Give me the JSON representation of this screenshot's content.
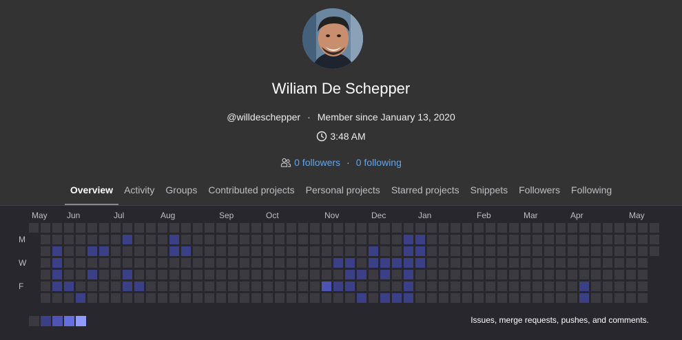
{
  "profile": {
    "name": "Wiliam De Schepper",
    "username": "@willdeschepper",
    "member_since": "Member since January 13, 2020",
    "local_time": "3:48 AM",
    "followers_label": "0 followers",
    "following_label": "0 following"
  },
  "tabs": [
    {
      "label": "Overview",
      "active": true
    },
    {
      "label": "Activity"
    },
    {
      "label": "Groups"
    },
    {
      "label": "Contributed projects"
    },
    {
      "label": "Personal projects"
    },
    {
      "label": "Starred projects"
    },
    {
      "label": "Snippets"
    },
    {
      "label": "Followers"
    },
    {
      "label": "Following"
    }
  ],
  "calendar": {
    "months": [
      "May",
      "Jun",
      "Jul",
      "Aug",
      "Sep",
      "Oct",
      "Nov",
      "Dec",
      "Jan",
      "Feb",
      "Mar",
      "Apr",
      "May"
    ],
    "day_labels": [
      "M",
      "W",
      "F"
    ],
    "legend_text": "Issues, merge requests, pushes, and comments.",
    "colors": {
      "level0": "#3b3a40",
      "level1": "#3b3f86",
      "level2": "#4e54b4",
      "level3": "#666fe0",
      "level4": "#8f9bff"
    },
    "cells": [
      [
        0,
        -1,
        -1,
        -1,
        -1,
        -1,
        -1
      ],
      [
        0,
        0,
        0,
        0,
        0,
        0,
        0
      ],
      [
        0,
        0,
        1,
        1,
        1,
        1,
        0
      ],
      [
        0,
        0,
        0,
        0,
        0,
        1,
        0
      ],
      [
        0,
        0,
        0,
        0,
        0,
        0,
        1
      ],
      [
        0,
        0,
        1,
        0,
        1,
        0,
        0
      ],
      [
        0,
        0,
        1,
        0,
        0,
        0,
        0
      ],
      [
        0,
        0,
        0,
        0,
        0,
        0,
        0
      ],
      [
        0,
        1,
        0,
        0,
        1,
        1,
        0
      ],
      [
        0,
        0,
        0,
        0,
        0,
        1,
        0
      ],
      [
        0,
        0,
        0,
        0,
        0,
        0,
        0
      ],
      [
        0,
        0,
        0,
        0,
        0,
        0,
        0
      ],
      [
        0,
        1,
        1,
        0,
        0,
        0,
        0
      ],
      [
        0,
        0,
        1,
        0,
        0,
        0,
        0
      ],
      [
        0,
        0,
        0,
        0,
        0,
        0,
        0
      ],
      [
        0,
        0,
        0,
        0,
        0,
        0,
        0
      ],
      [
        0,
        0,
        0,
        0,
        0,
        0,
        0
      ],
      [
        0,
        0,
        0,
        0,
        0,
        0,
        0
      ],
      [
        0,
        0,
        0,
        0,
        0,
        0,
        0
      ],
      [
        0,
        0,
        0,
        0,
        0,
        0,
        0
      ],
      [
        0,
        0,
        0,
        0,
        0,
        0,
        0
      ],
      [
        0,
        0,
        0,
        0,
        0,
        0,
        0
      ],
      [
        0,
        0,
        0,
        0,
        0,
        0,
        0
      ],
      [
        0,
        0,
        0,
        0,
        0,
        0,
        0
      ],
      [
        0,
        0,
        0,
        0,
        0,
        0,
        0
      ],
      [
        0,
        0,
        0,
        0,
        0,
        2,
        0
      ],
      [
        0,
        0,
        0,
        1,
        0,
        1,
        0
      ],
      [
        0,
        0,
        0,
        1,
        1,
        1,
        0
      ],
      [
        0,
        0,
        0,
        0,
        1,
        0,
        1
      ],
      [
        0,
        0,
        1,
        1,
        0,
        0,
        0
      ],
      [
        0,
        0,
        0,
        1,
        1,
        0,
        1
      ],
      [
        0,
        0,
        0,
        1,
        0,
        0,
        1
      ],
      [
        0,
        1,
        1,
        1,
        1,
        1,
        1
      ],
      [
        0,
        1,
        1,
        1,
        0,
        0,
        0
      ],
      [
        0,
        0,
        0,
        0,
        0,
        0,
        0
      ],
      [
        0,
        0,
        0,
        0,
        0,
        0,
        0
      ],
      [
        0,
        0,
        0,
        0,
        0,
        0,
        0
      ],
      [
        0,
        0,
        0,
        0,
        0,
        0,
        0
      ],
      [
        0,
        0,
        0,
        0,
        0,
        0,
        0
      ],
      [
        0,
        0,
        0,
        0,
        0,
        0,
        0
      ],
      [
        0,
        0,
        0,
        0,
        0,
        0,
        0
      ],
      [
        0,
        0,
        0,
        0,
        0,
        0,
        0
      ],
      [
        0,
        0,
        0,
        0,
        0,
        0,
        0
      ],
      [
        0,
        0,
        0,
        0,
        0,
        0,
        0
      ],
      [
        0,
        0,
        0,
        0,
        0,
        0,
        0
      ],
      [
        0,
        0,
        0,
        0,
        0,
        0,
        0
      ],
      [
        0,
        0,
        0,
        0,
        0,
        0,
        0
      ],
      [
        0,
        0,
        0,
        0,
        0,
        1,
        1
      ],
      [
        0,
        0,
        0,
        0,
        0,
        0,
        0
      ],
      [
        0,
        0,
        0,
        0,
        0,
        0,
        0
      ],
      [
        0,
        0,
        0,
        0,
        0,
        0,
        0
      ],
      [
        0,
        0,
        0,
        0,
        0,
        0,
        0
      ],
      [
        0,
        0,
        0,
        0,
        0,
        0,
        0
      ],
      [
        0,
        0,
        0,
        -1,
        -1,
        -1,
        -1
      ]
    ]
  }
}
